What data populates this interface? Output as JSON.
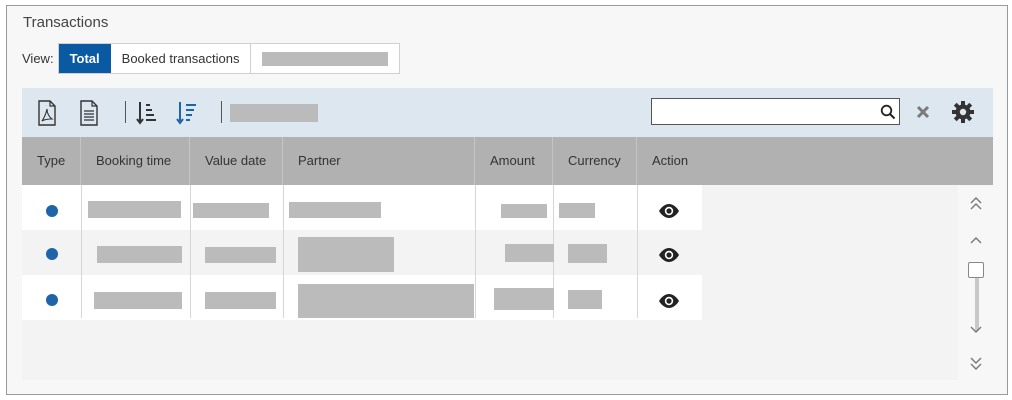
{
  "panel": {
    "title": "Transactions"
  },
  "view": {
    "label": "View:",
    "options": [
      {
        "label": "Total",
        "active": true
      },
      {
        "label": "Booked transactions",
        "active": false
      },
      {
        "label": "",
        "active": false
      }
    ]
  },
  "toolbar": {
    "icons": [
      "pdf-export-icon",
      "document-export-icon",
      "sort-ascending-icon",
      "sort-descending-icon",
      "search-icon",
      "clear-icon",
      "gear-icon"
    ],
    "search": {
      "value": "",
      "placeholder": ""
    }
  },
  "table": {
    "columns": [
      "Type",
      "Booking time",
      "Value date",
      "Partner",
      "Amount",
      "Currency",
      "Action"
    ],
    "rows": [
      {
        "type_status": "booked",
        "action": "view"
      },
      {
        "type_status": "booked",
        "action": "view"
      },
      {
        "type_status": "booked",
        "action": "view"
      }
    ]
  },
  "colors": {
    "accent": "#0a5aa3",
    "status_dot": "#1f64a8",
    "toolbar_bg": "#dde7f0",
    "header_bg": "#b1b1b1"
  }
}
